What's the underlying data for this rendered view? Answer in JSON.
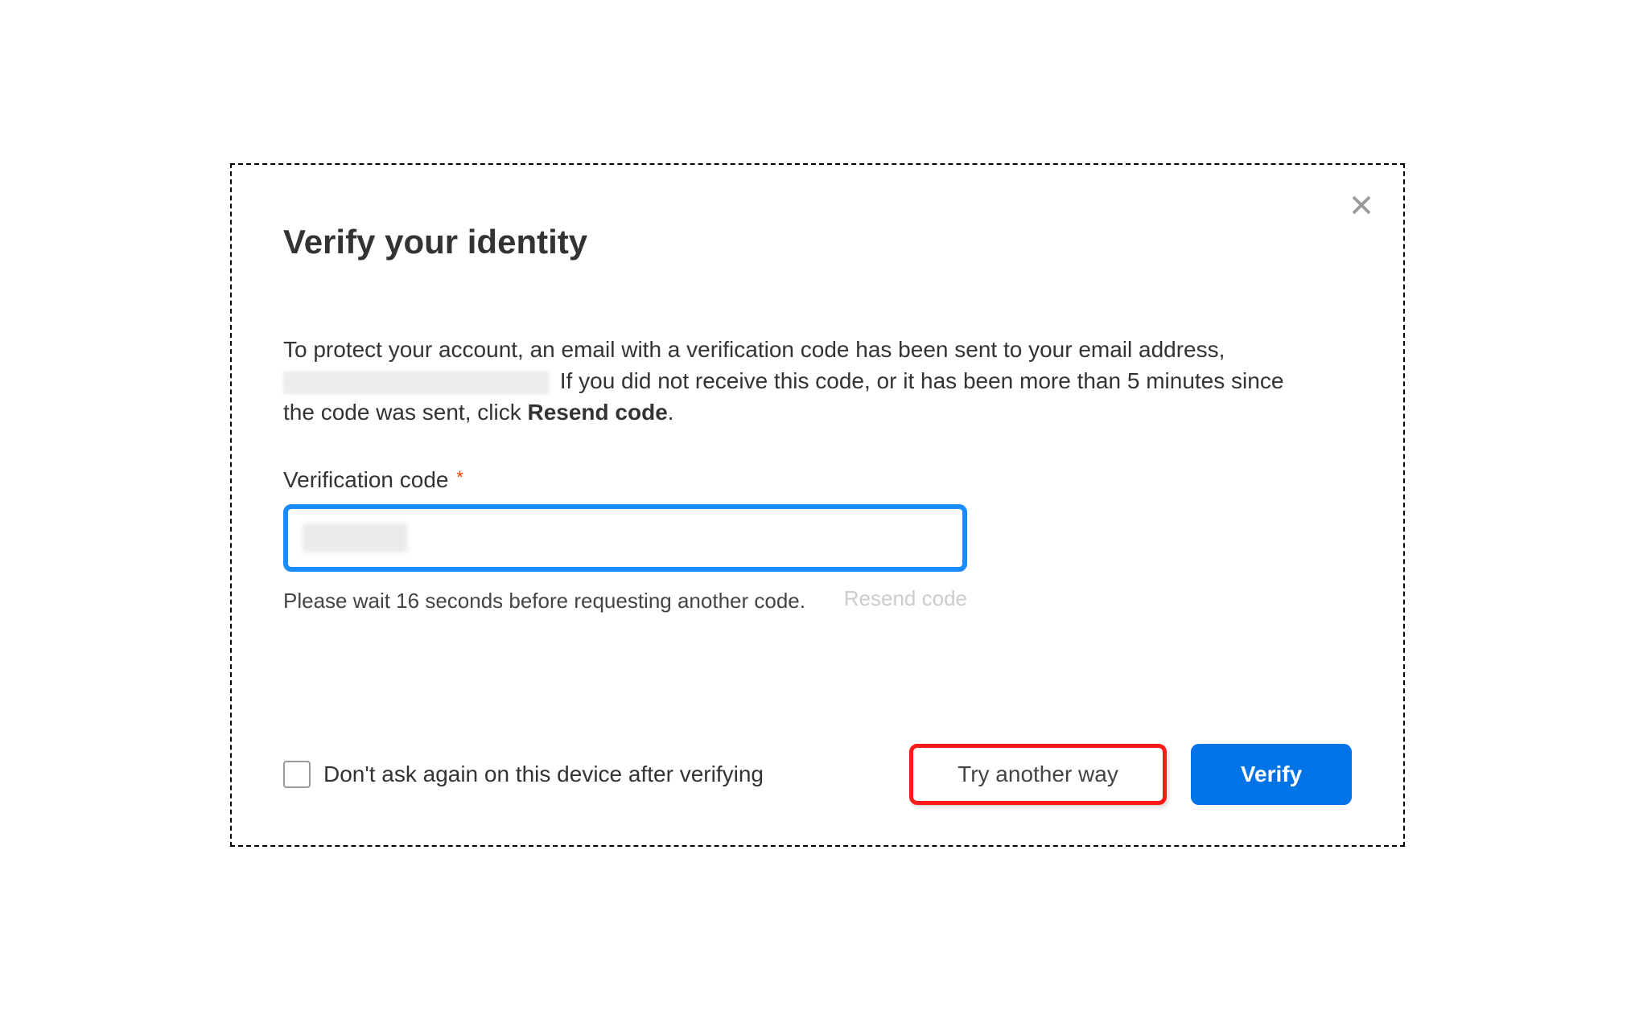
{
  "modal": {
    "title": "Verify your identity",
    "description_part1": "To protect your account, an email with a verification code has been sent to your email address,",
    "description_part2": " If you did not receive this code, or it has been more than 5 minutes since the code was sent, click ",
    "description_bold": "Resend code",
    "description_period": ".",
    "field_label": "Verification code",
    "wait_message": "Please wait 16 seconds before requesting another code.",
    "resend_label": "Resend code",
    "checkbox_label": "Don't ask again on this device after verifying",
    "try_another_label": "Try another way",
    "verify_label": "Verify"
  }
}
